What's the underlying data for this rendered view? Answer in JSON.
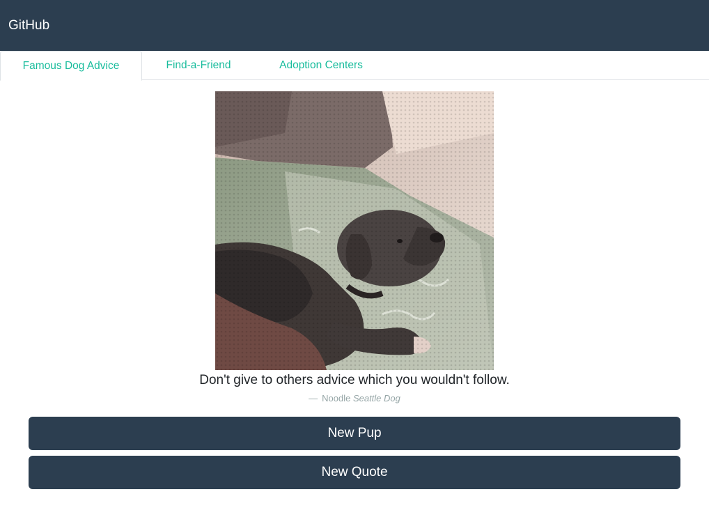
{
  "navbar": {
    "brand": "GitHub"
  },
  "tabs": [
    {
      "label": "Famous Dog Advice",
      "active": true
    },
    {
      "label": "Find-a-Friend",
      "active": false
    },
    {
      "label": "Adoption Centers",
      "active": false
    }
  ],
  "quote": {
    "text": "Don't give to others advice which you wouldn't follow.",
    "dash": "—",
    "author": "Noodle",
    "source": "Seattle Dog"
  },
  "buttons": {
    "new_pup": "New Pup",
    "new_quote": "New Quote"
  },
  "colors": {
    "navbar": "#2c3e50",
    "accent": "#18bc9c",
    "button": "#2c3e50",
    "muted": "#95a5a6"
  }
}
